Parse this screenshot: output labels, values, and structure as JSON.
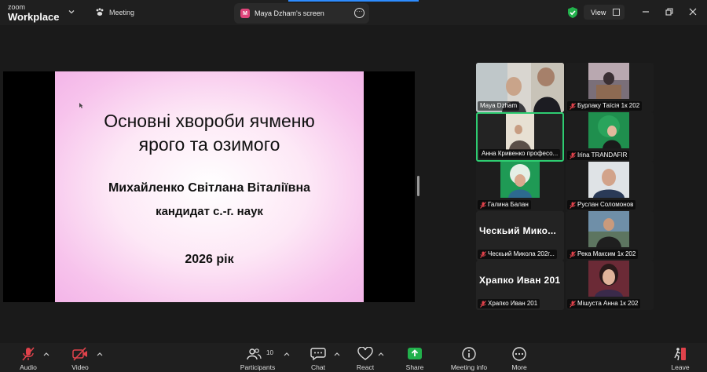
{
  "app": {
    "brand_top": "zoom",
    "brand_bottom": "Workplace",
    "meeting_label": "Meeting"
  },
  "screen_tab": {
    "avatar_letter": "M",
    "label": "Maya Dzham's screen"
  },
  "view_label": "View",
  "colors": {
    "accent": "#2d8cff",
    "active_speaker": "#2ecc71",
    "muted": "#e0424b",
    "slide_pink": "#f7c3ec"
  },
  "slide": {
    "title_line1": "Основні хвороби ячменю",
    "title_line2": "ярого та озимого",
    "author": "Михайленко Світлана Віталіївна",
    "degree": "кандидат с.-г. наук",
    "year": "2026 рік"
  },
  "participants": [
    {
      "name": "Maya Dzham",
      "muted": false,
      "type": "video"
    },
    {
      "name": "Бурлаку Таїсія 1к 202",
      "muted": true,
      "type": "photo"
    },
    {
      "name": "Анна Кривенко професо...",
      "muted": false,
      "type": "video",
      "active": true
    },
    {
      "name": "Irina TRANDAFIR",
      "muted": true,
      "type": "photo"
    },
    {
      "name": "Галина Балан",
      "muted": true,
      "type": "photo"
    },
    {
      "name": "Руслан Соломонов",
      "muted": true,
      "type": "photo"
    },
    {
      "name": "Ческьий Микола 202г...",
      "display": "Ческьий Мико...",
      "muted": true,
      "type": "text"
    },
    {
      "name": "Река Максим 1к 202",
      "muted": true,
      "type": "photo"
    },
    {
      "name": "Храпко Иван 201",
      "display": "Храпко Иван 201",
      "muted": true,
      "type": "text"
    },
    {
      "name": "Мішуста Анна 1к 202",
      "muted": true,
      "type": "photo"
    }
  ],
  "toolbar": {
    "audio": "Audio",
    "video": "Video",
    "participants": "Participants",
    "participants_count": "10",
    "chat": "Chat",
    "react": "React",
    "share": "Share",
    "meeting_info": "Meeting info",
    "more": "More",
    "leave": "Leave"
  }
}
